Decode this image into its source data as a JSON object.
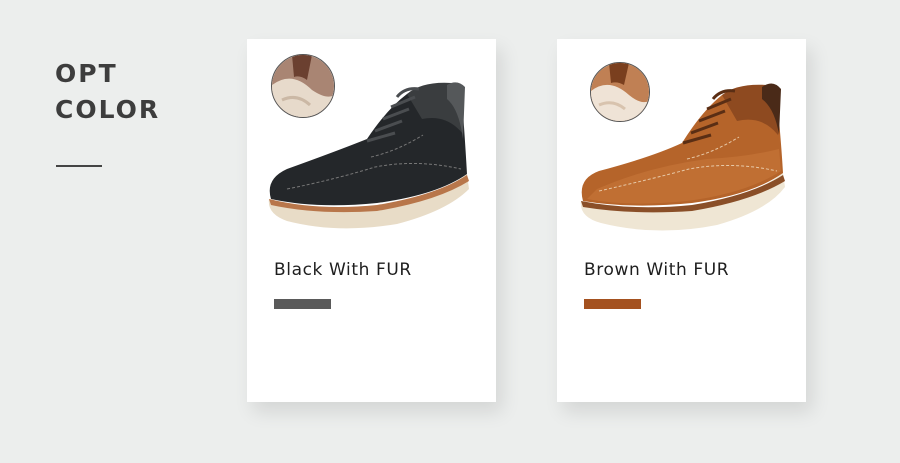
{
  "heading": {
    "line1": "OPT",
    "line2": "COLOR"
  },
  "options": [
    {
      "label": "Black With FUR",
      "swatch_color": "#5a5a5a",
      "icons": [
        "fur-lining-detail-icon",
        "black-boot-image"
      ]
    },
    {
      "label": "Brown With FUR",
      "swatch_color": "#a4511f",
      "icons": [
        "fur-lining-detail-icon",
        "brown-boot-image"
      ]
    }
  ]
}
